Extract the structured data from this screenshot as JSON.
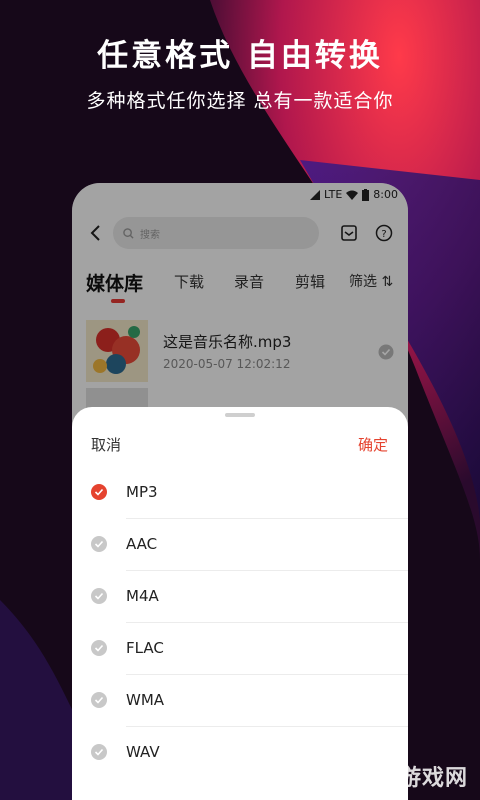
{
  "promo": {
    "headline": "任意格式 自由转换",
    "subline": "多种格式任你选择 总有一款适合你"
  },
  "status_bar": {
    "network": "LTE",
    "time": "8:00"
  },
  "toolbar": {
    "search_placeholder": "搜索",
    "icons": [
      "back-icon",
      "search-icon",
      "inbox-icon",
      "help-icon"
    ]
  },
  "tabs": [
    {
      "label": "媒体库",
      "active": true
    },
    {
      "label": "下载",
      "active": false
    },
    {
      "label": "录音",
      "active": false
    },
    {
      "label": "剪辑",
      "active": false
    }
  ],
  "filter_label": "筛选",
  "files": [
    {
      "name": "这是音乐名称.mp3",
      "date": "2020-05-07  12:02:12"
    },
    {
      "name": "",
      "date": ""
    }
  ],
  "sheet": {
    "cancel_label": "取消",
    "confirm_label": "确定",
    "options": [
      {
        "label": "MP3",
        "selected": true
      },
      {
        "label": "AAC",
        "selected": false
      },
      {
        "label": "M4A",
        "selected": false
      },
      {
        "label": "FLAC",
        "selected": false
      },
      {
        "label": "WMA",
        "selected": false
      },
      {
        "label": "WAV",
        "selected": false
      }
    ]
  },
  "colors": {
    "accent": "#e5432f",
    "background": "#140819"
  },
  "watermark": "007游戏网"
}
